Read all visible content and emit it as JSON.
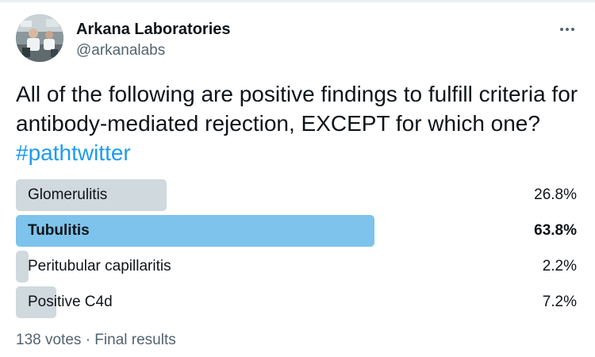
{
  "account": {
    "display_name": "Arkana Laboratories",
    "handle": "@arkanalabs"
  },
  "tweet": {
    "text": "All of the following are positive findings to fulfill criteria for antibody-mediated rejection, EXCEPT for which one? ",
    "hashtag": "#pathtwitter"
  },
  "poll": {
    "options": [
      {
        "label": "Glomerulitis",
        "percent_text": "26.8%",
        "percent": 26.8,
        "winner": false
      },
      {
        "label": "Tubulitis",
        "percent_text": "63.8%",
        "percent": 63.8,
        "winner": true
      },
      {
        "label": "Peritubular capillaritis",
        "percent_text": "2.2%",
        "percent": 2.2,
        "winner": false
      },
      {
        "label": "Positive C4d",
        "percent_text": "7.2%",
        "percent": 7.2,
        "winner": false
      }
    ],
    "votes": "138 votes",
    "separator": "·",
    "status": "Final results"
  },
  "icons": {
    "more": "more-horizontal-icon",
    "avatar": "lab-photo-avatar"
  },
  "colors": {
    "winner_bar": "#7dc3ec",
    "bar": "#cfd9de",
    "hashtag": "#1d9bf0",
    "muted_text": "#536471"
  }
}
